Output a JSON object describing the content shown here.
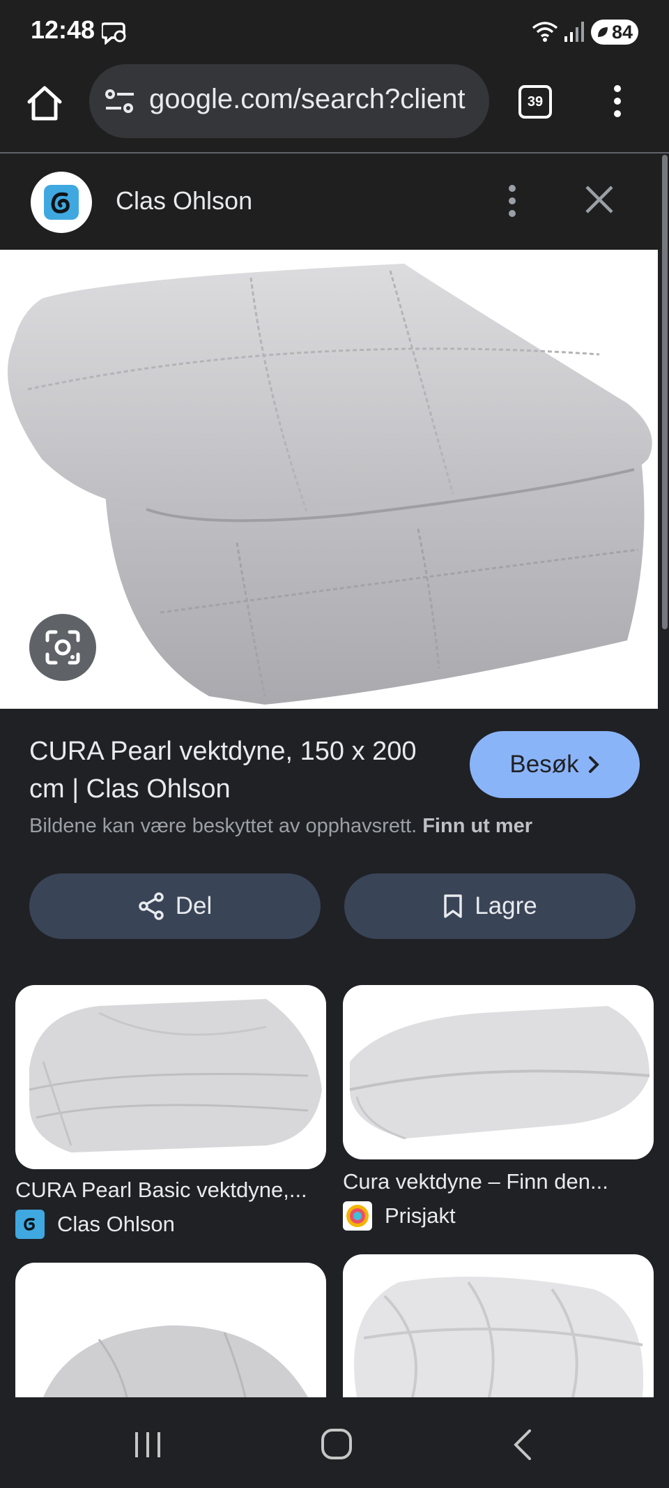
{
  "status": {
    "time": "12:48",
    "battery": "84"
  },
  "browser": {
    "url": "google.com/search?client",
    "tab_count": "39"
  },
  "source": {
    "name": "Clas Ohlson"
  },
  "result": {
    "title": "CURA Pearl vektdyne, 150 x 200 cm | Clas Ohlson",
    "visit_label": "Besøk",
    "copyright_text": "Bildene kan være beskyttet av opphavsrett.",
    "learn_more": "Finn ut mer",
    "share_label": "Del",
    "save_label": "Lagre"
  },
  "related": [
    {
      "title": "CURA Pearl Basic vektdyne,...",
      "source": "Clas Ohlson"
    },
    {
      "title": "Cura vektdyne – Finn den...",
      "source": "Prisjakt"
    }
  ],
  "colors": {
    "accent": "#8ab4f8",
    "chip": "#394457",
    "background": "#202124"
  }
}
